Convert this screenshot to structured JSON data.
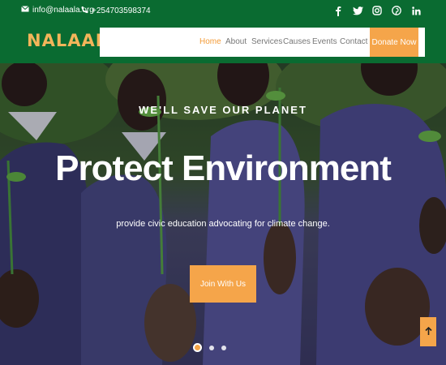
{
  "topbar": {
    "email": "info@nalaala.org",
    "phone": "+254703598374",
    "socials": [
      "facebook-icon",
      "twitter-icon",
      "instagram-icon",
      "pinterest-icon",
      "linkedin-icon"
    ]
  },
  "header": {
    "logo": "NALAALA",
    "nav": [
      "Home",
      "About",
      "Services",
      "Causes",
      "Events",
      "Contact"
    ],
    "active_nav": "Home",
    "donate_label": "Donate Now"
  },
  "hero": {
    "eyebrow": "WE'LL SAVE OUR PLANET",
    "headline": "Protect Environment",
    "subline": "provide civic education advocating for climate change.",
    "cta_label": "Join With Us",
    "slides": 3,
    "active_slide": 1
  },
  "colors": {
    "brand_green": "#0a6b31",
    "accent_orange": "#f5a54a",
    "logo_gold": "#f3b55a"
  },
  "icons": {
    "email": "envelope-icon",
    "phone": "phone-icon",
    "back_to_top": "arrow-up-icon"
  }
}
